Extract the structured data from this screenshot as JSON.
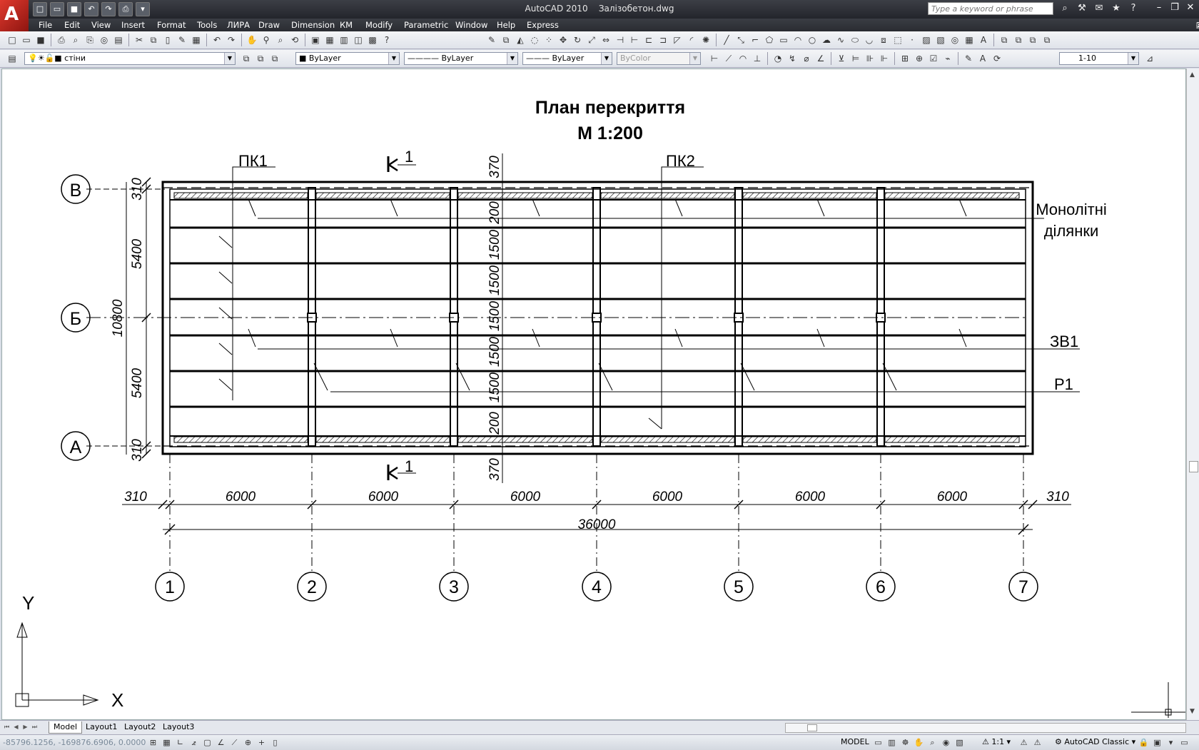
{
  "app": {
    "title": "AutoCAD 2010",
    "file": "Залізобетон.dwg",
    "search_placeholder": "Type a keyword or phrase"
  },
  "menu": [
    "File",
    "Edit",
    "View",
    "Insert",
    "Format",
    "Tools",
    "ЛИРА",
    "Draw",
    "Dimension",
    "КМ",
    "Modify",
    "Parametric",
    "Window",
    "Help",
    "Express"
  ],
  "layers": {
    "layer_name": "стіни",
    "color": "ByLayer",
    "linetype": "ByLayer",
    "lineweight": "ByLayer",
    "plotstyle": "ByColor",
    "dimstyle": "1-10"
  },
  "drawing": {
    "title_line1": "План перекриття",
    "title_line2": "М 1:200",
    "mark_pk1": "ПК1",
    "mark_pk2": "ПК2",
    "label_monolith_1": "Монолітні",
    "label_monolith_2": "ділянки",
    "label_zv1": "ЗВ1",
    "label_r1": "Р1",
    "section_top": "1",
    "section_bottom": "1",
    "axes_rows": [
      "В",
      "Б",
      "А"
    ],
    "axes_cols": [
      "1",
      "2",
      "3",
      "4",
      "5",
      "6",
      "7"
    ],
    "dims_bays": [
      "6000",
      "6000",
      "6000",
      "6000",
      "6000",
      "6000"
    ],
    "dim_left_edge": "310",
    "dim_right_edge": "310",
    "dim_total": "36000",
    "dims_left": [
      "310",
      "5400",
      "5400",
      "310"
    ],
    "dim_left_total": "10800",
    "dims_mid_vertical": [
      "370",
      "200",
      "1500",
      "1500",
      "1500",
      "1500",
      "1500",
      "200",
      "370"
    ],
    "ucs_x": "X",
    "ucs_y": "Y"
  },
  "tabs": [
    "Model",
    "Layout1",
    "Layout2",
    "Layout3"
  ],
  "status": {
    "coords": "-85796.1256, -169876.6906, 0.0000",
    "model": "MODEL",
    "scale": "1:1",
    "workspace": "AutoCAD Classic"
  }
}
